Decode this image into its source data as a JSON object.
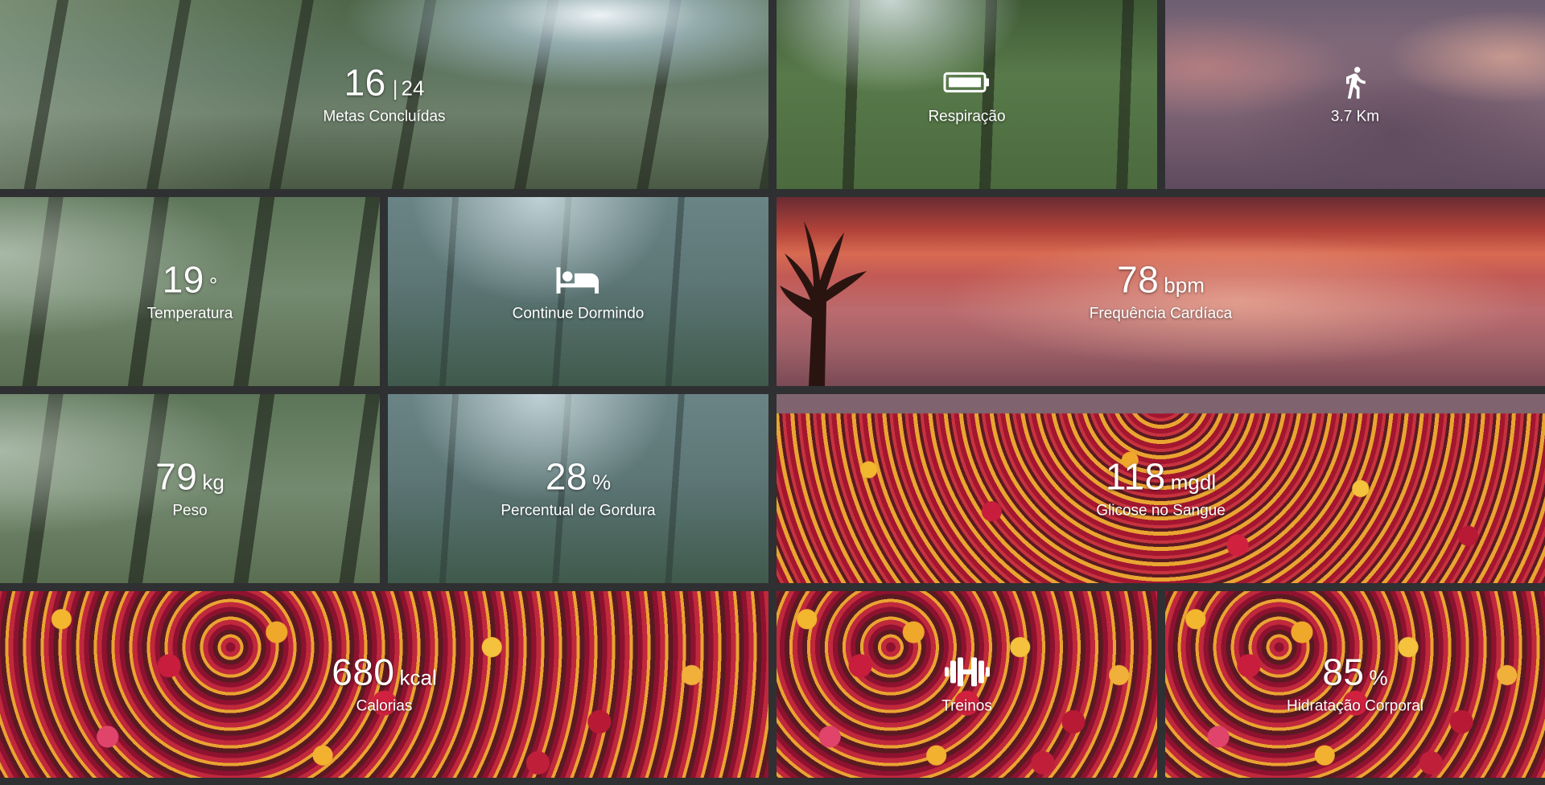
{
  "tiles": [
    {
      "id": "metas",
      "value": "16",
      "separator": "|",
      "secondary": "24",
      "label": "Metas Concluídas"
    },
    {
      "id": "respiracao",
      "icon": "battery-icon",
      "label": "Respiração"
    },
    {
      "id": "distancia",
      "icon": "running-icon",
      "label": "3.7 Km"
    },
    {
      "id": "temperatura",
      "value": "19",
      "unit": "°",
      "label": "Temperatura"
    },
    {
      "id": "sono",
      "icon": "bed-icon",
      "label": "Continue Dormindo"
    },
    {
      "id": "frequencia",
      "value": "78",
      "unit": "bpm",
      "label": "Frequência Cardíaca"
    },
    {
      "id": "peso",
      "value": "79",
      "unit": "kg",
      "label": "Peso"
    },
    {
      "id": "gordura",
      "value": "28",
      "unit": "%",
      "label": "Percentual de Gordura"
    },
    {
      "id": "glicose",
      "value": "118",
      "unit": "mgdl",
      "label": "Glicose no Sangue"
    },
    {
      "id": "calorias",
      "value": "680",
      "unit": "kcal",
      "label": "Calorias"
    },
    {
      "id": "treinos",
      "icon": "dumbbell-icon",
      "label": "Treinos"
    },
    {
      "id": "hidratacao",
      "value": "85",
      "unit": "%",
      "label": "Hidratação Corporal"
    }
  ]
}
